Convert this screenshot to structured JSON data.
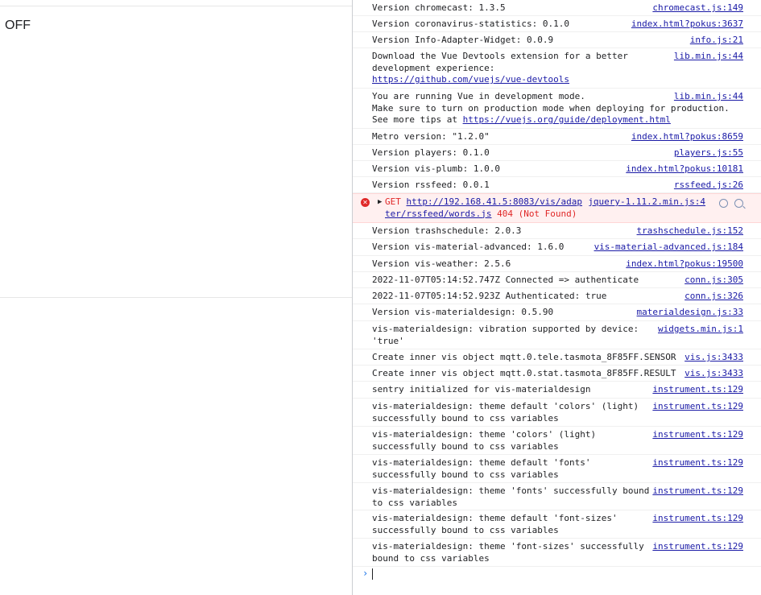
{
  "page": {
    "status_text": "OFF"
  },
  "console": {
    "messages": [
      {
        "text": "Version chromecast: 1.3.5",
        "source": "chromecast.js:149"
      },
      {
        "text": "Version coronavirus-statistics: 0.1.0",
        "source": "index.html?pokus:3637"
      },
      {
        "text": "Version Info-Adapter-Widget: 0.0.9",
        "source": "info.js:21"
      },
      {
        "text_lines": [
          "Download the Vue Devtools extension for a better",
          "development experience:"
        ],
        "link": "https://github.com/vuejs/vue-devtools",
        "source": "lib.min.js:44"
      },
      {
        "text_lines": [
          "You are running Vue in development mode.",
          "Make sure to turn on production mode when deploying for production."
        ],
        "prefix": "See more tips at ",
        "link": "https://vuejs.org/guide/deployment.html",
        "source": "lib.min.js:44"
      },
      {
        "text": "Metro version: \"1.2.0\"",
        "source": "index.html?pokus:8659"
      },
      {
        "text": "Version players: 0.1.0",
        "source": "players.js:55"
      },
      {
        "text": "Version vis-plumb: 1.0.0",
        "source": "index.html?pokus:10181"
      },
      {
        "text": "Version rssfeed: 0.0.1",
        "source": "rssfeed.js:26"
      }
    ],
    "error": {
      "method": "GET",
      "url_line1": "http://192.168.41.5:8083/vis/adap",
      "url_line2": "ter/rssfeed/words.js",
      "status": "404 (Not Found)",
      "source": "jquery-1.11.2.min.js:4"
    },
    "messages2": [
      {
        "text": "Version trashschedule: 2.0.3",
        "source": "trashschedule.js:152"
      },
      {
        "text": "Version vis-material-advanced: 1.6.0",
        "source": "vis-material-advanced.js:184"
      },
      {
        "text": "Version vis-weather: 2.5.6",
        "source": "index.html?pokus:19500"
      },
      {
        "text": "2022-11-07T05:14:52.747Z Connected => authenticate",
        "source": "conn.js:305"
      },
      {
        "text": "2022-11-07T05:14:52.923Z Authenticated: true",
        "source": "conn.js:326"
      },
      {
        "text": "Version vis-materialdesign: 0.5.90",
        "source": "materialdesign.js:33"
      },
      {
        "text_lines": [
          "vis-materialdesign: vibration supported by device:",
          "'true'"
        ],
        "source": "widgets.min.js:1"
      },
      {
        "text": "Create inner vis object mqtt.0.tele.tasmota_8F85FF.SENSOR",
        "source": "vis.js:3433"
      },
      {
        "text": "Create inner vis object mqtt.0.stat.tasmota_8F85FF.RESULT",
        "source": "vis.js:3433"
      },
      {
        "text": "sentry initialized for vis-materialdesign",
        "source": "instrument.ts:129"
      },
      {
        "text_lines": [
          "vis-materialdesign: theme default 'colors' (light)",
          "successfully bound to css variables"
        ],
        "source": "instrument.ts:129"
      },
      {
        "text_lines": [
          "vis-materialdesign: theme 'colors' (light)",
          "successfully bound to css variables"
        ],
        "source": "instrument.ts:129"
      },
      {
        "text_lines": [
          "vis-materialdesign: theme default 'fonts'",
          "successfully bound to css variables"
        ],
        "source": "instrument.ts:129"
      },
      {
        "text_lines": [
          "vis-materialdesign: theme 'fonts' successfully bound",
          "to css variables"
        ],
        "source": "instrument.ts:129"
      },
      {
        "text_lines": [
          "vis-materialdesign: theme default 'font-sizes'",
          "successfully bound to css variables"
        ],
        "source": "instrument.ts:129"
      },
      {
        "text_lines": [
          "vis-materialdesign: theme 'font-sizes' successfully",
          "bound to css variables"
        ],
        "source": "instrument.ts:129"
      }
    ],
    "prompt_symbol": "›"
  }
}
